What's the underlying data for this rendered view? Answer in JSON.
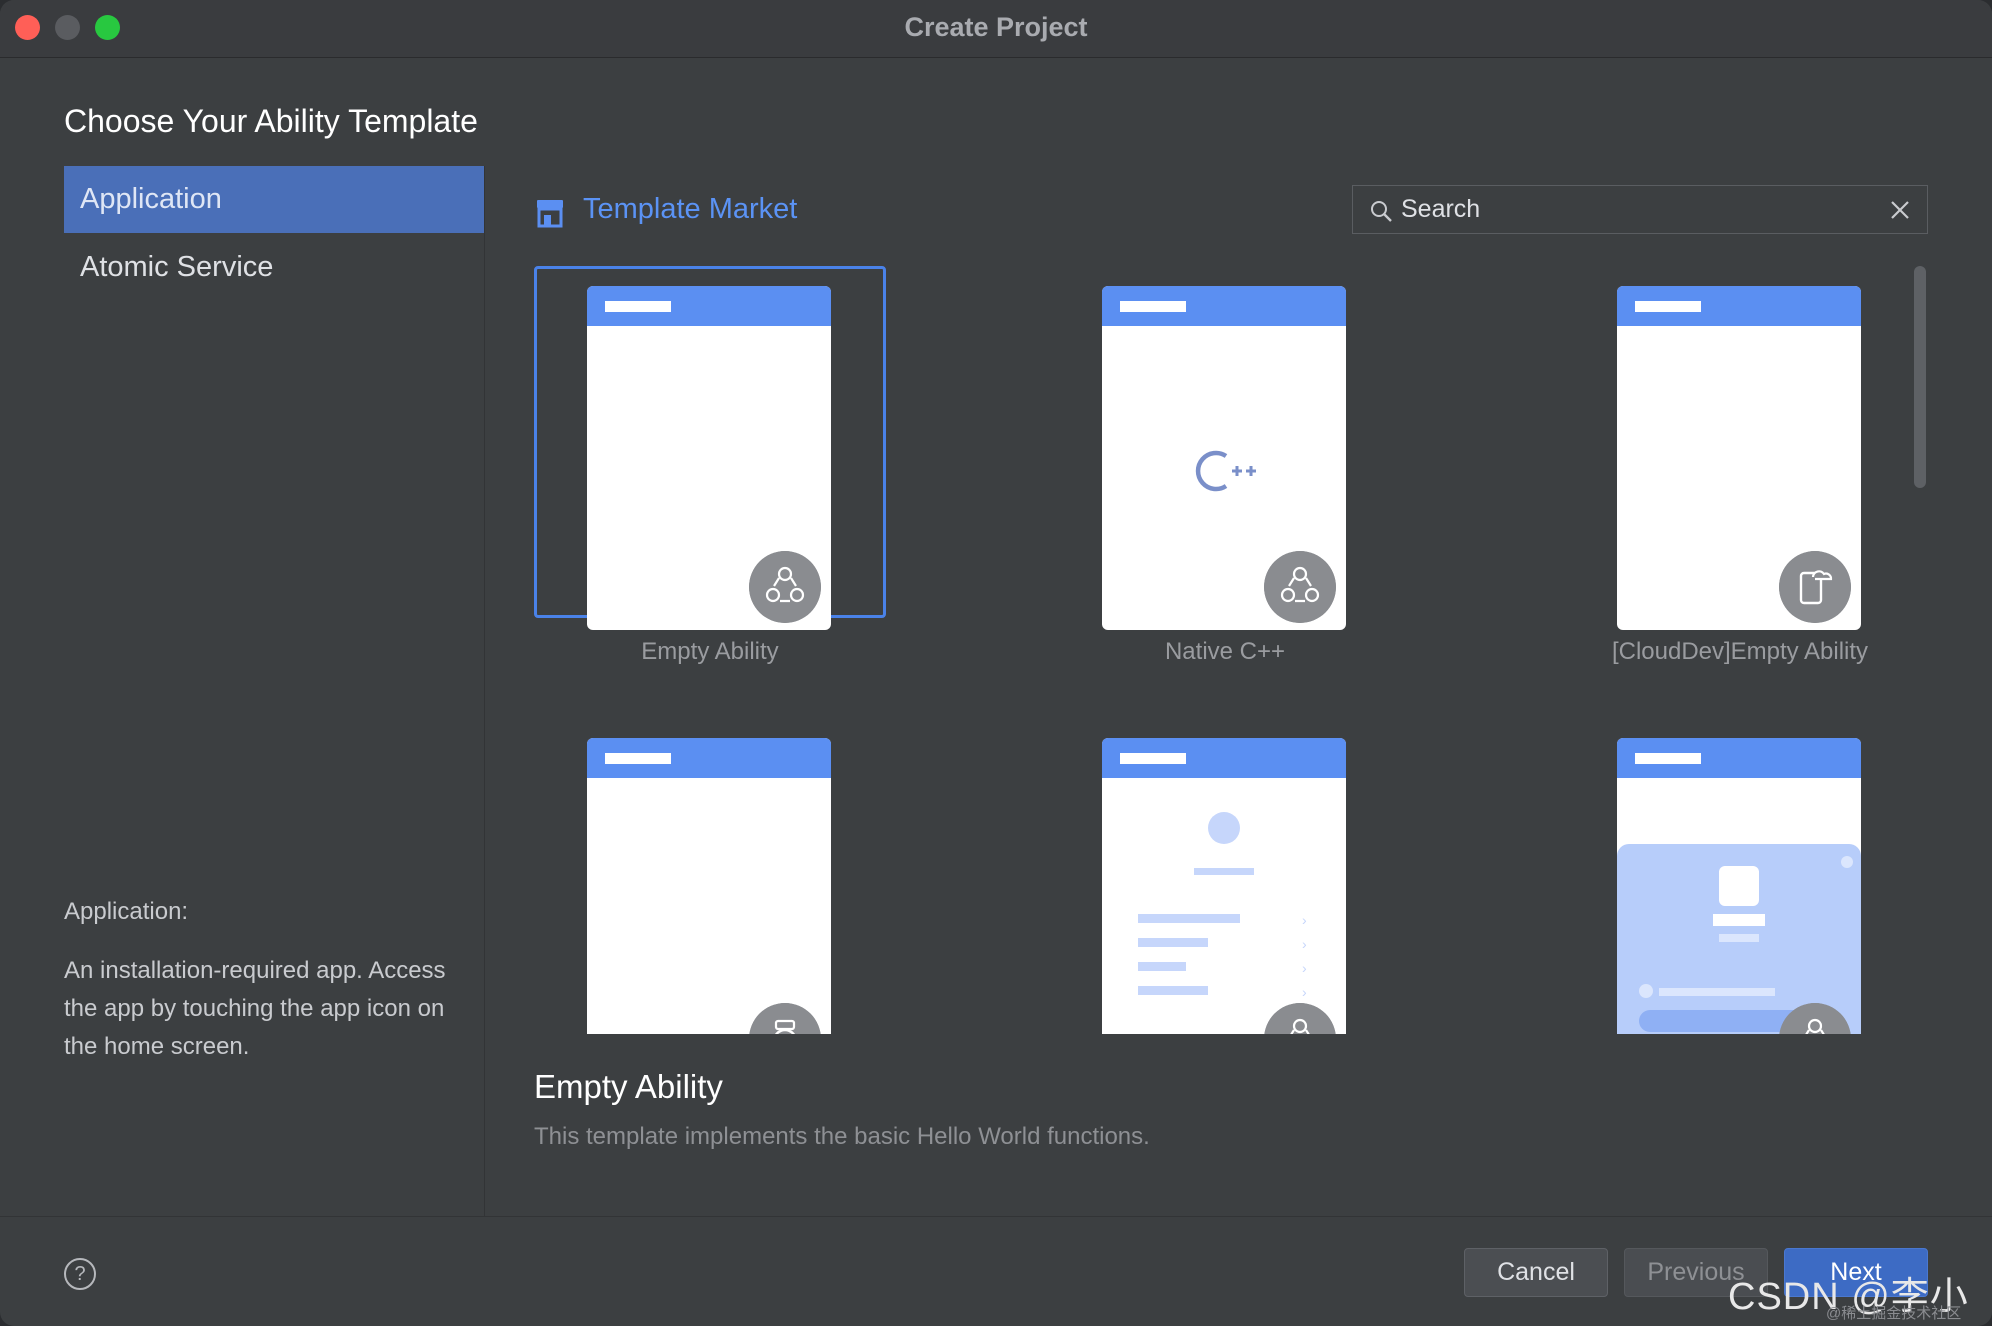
{
  "window": {
    "title": "Create Project"
  },
  "heading": "Choose Your Ability Template",
  "sidebar": {
    "items": [
      {
        "label": "Application",
        "active": true
      },
      {
        "label": "Atomic Service",
        "active": false
      }
    ],
    "description_title": "Application:",
    "description": "An installation-required app. Access the app by touching the app icon on the home screen."
  },
  "market": {
    "label": "Template Market",
    "icon": "store-icon",
    "accent": "#5b93f5"
  },
  "search": {
    "placeholder": "Search",
    "value": ""
  },
  "templates": [
    {
      "label": "Empty Ability",
      "selected": true,
      "badge_icon": "ability-cluster-icon"
    },
    {
      "label": "Native C++",
      "selected": false,
      "badge_icon": "ability-cluster-icon",
      "center_icon": "cpp-icon"
    },
    {
      "label": "[CloudDev]Empty Ability",
      "selected": false,
      "badge_icon": "cloud-device-icon"
    },
    {
      "label": "",
      "selected": false,
      "badge_icon": "watch-icon"
    },
    {
      "label": "",
      "selected": false,
      "badge_icon": "ability-cluster-icon"
    },
    {
      "label": "",
      "selected": false,
      "badge_icon": "ability-cluster-icon"
    }
  ],
  "detail": {
    "title": "Empty Ability",
    "description": "This template implements the basic Hello World functions."
  },
  "footer": {
    "help_icon": "question-mark-icon",
    "cancel": "Cancel",
    "previous": "Previous",
    "next": "Next"
  },
  "watermark": {
    "text": "CSDN @李小轰",
    "sub": "@稀土掘金技术社区"
  },
  "colors": {
    "selection": "#4a82e8",
    "sidebar_active": "#4a6fb8",
    "phone_header": "#5b8ff2",
    "next_button": "#3d6bc4"
  }
}
